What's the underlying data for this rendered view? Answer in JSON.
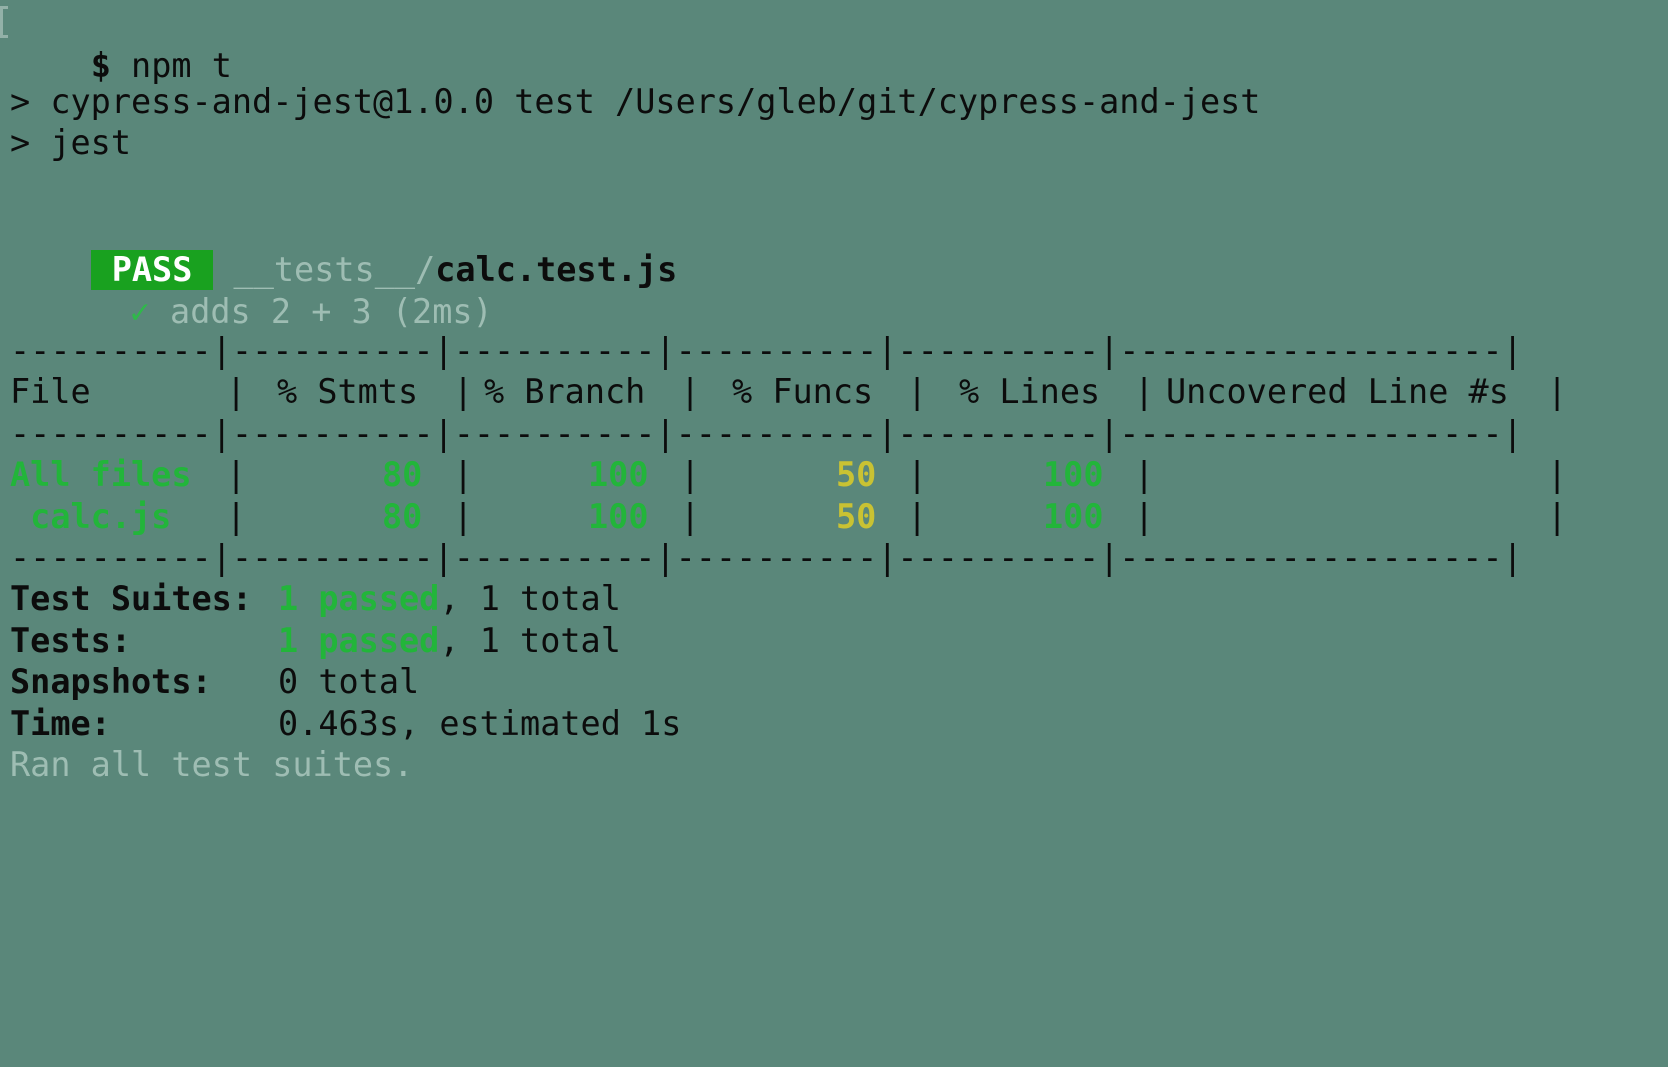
{
  "prompt": {
    "symbol": "$",
    "command": "npm t"
  },
  "script_lines": [
    "> cypress-and-jest@1.0.0 test /Users/gleb/git/cypress-and-jest",
    "> jest"
  ],
  "result": {
    "status": "PASS",
    "path_dir": "__tests__/",
    "path_file": "calc.test.js"
  },
  "test_case": {
    "check": "✓",
    "text": "adds 2 + 3 (2ms)"
  },
  "coverage": {
    "separator": "----------|----------|----------|----------|----------|-------------------|",
    "headers": [
      "File",
      "% Stmts",
      "% Branch",
      "% Funcs",
      "% Lines",
      "Uncovered Line #s"
    ],
    "rows": [
      {
        "file": "All files",
        "stmts": "80",
        "branch": "100",
        "funcs": "50",
        "lines": "100",
        "uncovered": ""
      },
      {
        "file": " calc.js",
        "stmts": "80",
        "branch": "100",
        "funcs": "50",
        "lines": "100",
        "uncovered": ""
      }
    ],
    "pipe": "|"
  },
  "summary": {
    "suites_label": "Test Suites:",
    "suites_passed": "1 passed",
    "suites_total": ", 1 total",
    "tests_label": "Tests:",
    "tests_passed": "1 passed",
    "tests_total": ", 1 total",
    "snapshots_label": "Snapshots:",
    "snapshots_value": "0 total",
    "time_label": "Time:",
    "time_value": "0.463s, estimated 1s",
    "footer": "Ran all test suites."
  },
  "colors": {
    "background": "#5a877a",
    "pass_badge": "#19a11f",
    "green": "#22b53a",
    "yellow": "#c9c233",
    "dim": "#9ebdb3"
  }
}
